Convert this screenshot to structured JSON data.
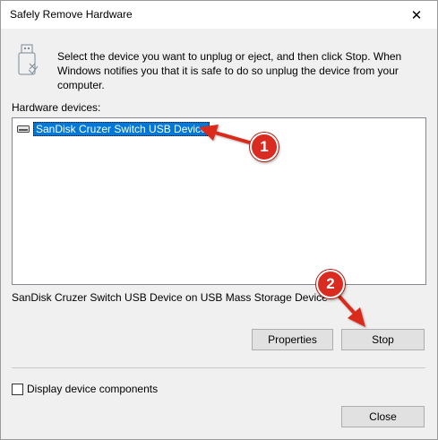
{
  "window": {
    "title": "Safely Remove Hardware",
    "close_glyph": "✕"
  },
  "instructions": "Select the device you want to unplug or eject, and then click Stop. When Windows notifies you that it is safe to do so unplug the device from your computer.",
  "hardware_devices_label": "Hardware devices:",
  "devices": [
    {
      "label": "SanDisk Cruzer Switch USB Device",
      "icon": "removable-drive-icon",
      "selected": true
    }
  ],
  "device_description": "SanDisk Cruzer Switch USB Device on USB Mass Storage Device",
  "buttons": {
    "properties": "Properties",
    "stop": "Stop",
    "close": "Close"
  },
  "display_components_label": "Display device components",
  "display_components_checked": false,
  "annotations": {
    "step1": "1",
    "step2": "2",
    "color": "#d92b1f"
  },
  "colors": {
    "selection": "#0078d7",
    "dialog_bg": "#f0f0f0",
    "button_bg": "#e1e1e1"
  }
}
